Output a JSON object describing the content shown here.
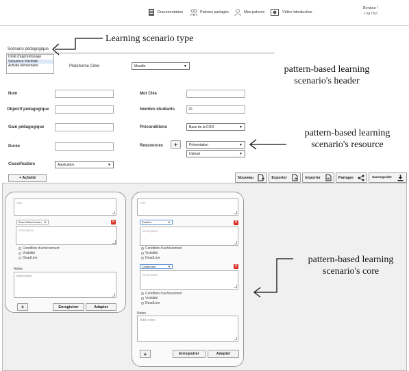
{
  "nav": {
    "items": [
      {
        "label": "Documentation",
        "icon": "document-icon"
      },
      {
        "label": "Patrons partagés",
        "icon": "shared-users-icon"
      },
      {
        "label": "Mes patrons",
        "icon": "user-icon"
      },
      {
        "label": "Vidéo introductive",
        "icon": "video-icon"
      }
    ],
    "greeting": "Bonjour !",
    "logout": "Log Out"
  },
  "scenario": {
    "label": "Scénario pédagogique",
    "types": [
      "Unité d'apprentissage",
      "Séquence d'activité",
      "Activité élémentaire"
    ],
    "selected_index": 1
  },
  "form": {
    "plateforme_label": "Plateforme Cible",
    "plateforme_value": "Moodle",
    "nom_label": "Nom",
    "mot_cles_label": "Mot Clés",
    "objectif_label": "Objectif pédagogique",
    "nombre_label": "Nombre étudiants",
    "nombre_value": "20",
    "gain_label": "Gain pédagogique",
    "preconditions_label": "Préconditions",
    "preconditions_value": "Base de la COO",
    "duree_label": "Durée",
    "ressources_label": "Ressources",
    "ressources_add": "+",
    "ressource_1": "Présentation",
    "ressource_2": "Upload",
    "classification_label": "Classification",
    "classification_value": "Application"
  },
  "toolbar": {
    "activite": "+  Activité",
    "nouveau": "Nouveau",
    "exporter": "Exporter",
    "importer": "Importer",
    "partager": "Partager",
    "sauvegarder": "Sauvegarder"
  },
  "panel1": {
    "title_placeholder": "Title",
    "activity_select": "Read Watch Listen",
    "description_placeholder": "Description",
    "checks": [
      "Condition d'achèvement",
      "Visibilité",
      "DeadLine"
    ],
    "notes_label": "Notes",
    "notes_placeholder": "Add notes",
    "add": "+",
    "save": "Enregistrer",
    "adapt": "Adapter"
  },
  "panel2": {
    "title_placeholder": "Title",
    "activity_select_1": "Practice",
    "description_placeholder_1": "Description",
    "activity_select_2": "Collaborate",
    "description_placeholder_2": "Description",
    "checks": [
      "Condition d'achèvement",
      "Visibilité",
      "DeadLine"
    ],
    "notes_label": "Notes",
    "notes_placeholder": "Add notes",
    "add": "+",
    "save": "Enregistrer",
    "adapt": "Adapter"
  },
  "annotations": {
    "type": "Learning scenario type",
    "header": "pattern-based learning scenario's header",
    "resource": "pattern-based learning scenario's resource",
    "core": "pattern-based learning scenario's core"
  }
}
